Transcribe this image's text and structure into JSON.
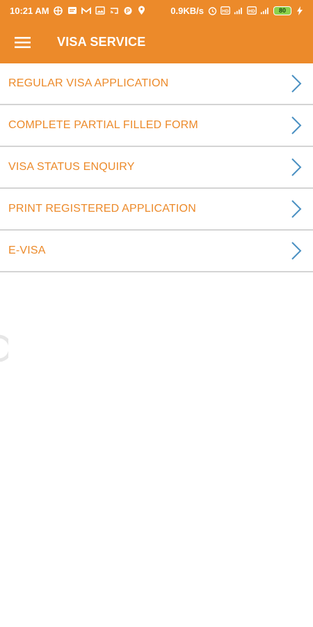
{
  "status_bar": {
    "time": "10:21 AM",
    "net_speed": "0.9KB/s",
    "battery": "80"
  },
  "app_bar": {
    "title": "VISA SERVICE",
    "menu_icon": "hamburger-menu-icon"
  },
  "menu_items": [
    {
      "label": "REGULAR VISA APPLICATION",
      "icon": "chevron-right-icon"
    },
    {
      "label": "COMPLETE PARTIAL FILLED FORM",
      "icon": "chevron-right-icon"
    },
    {
      "label": "VISA STATUS ENQUIRY",
      "icon": "chevron-right-icon"
    },
    {
      "label": "PRINT REGISTERED APPLICATION",
      "icon": "chevron-right-icon"
    },
    {
      "label": "E-VISA",
      "icon": "chevron-right-icon"
    }
  ],
  "colors": {
    "primary": "#ec8a2a",
    "divider": "#d4d4d4",
    "chevron": "#4a90c2",
    "background": "#ffffff"
  }
}
